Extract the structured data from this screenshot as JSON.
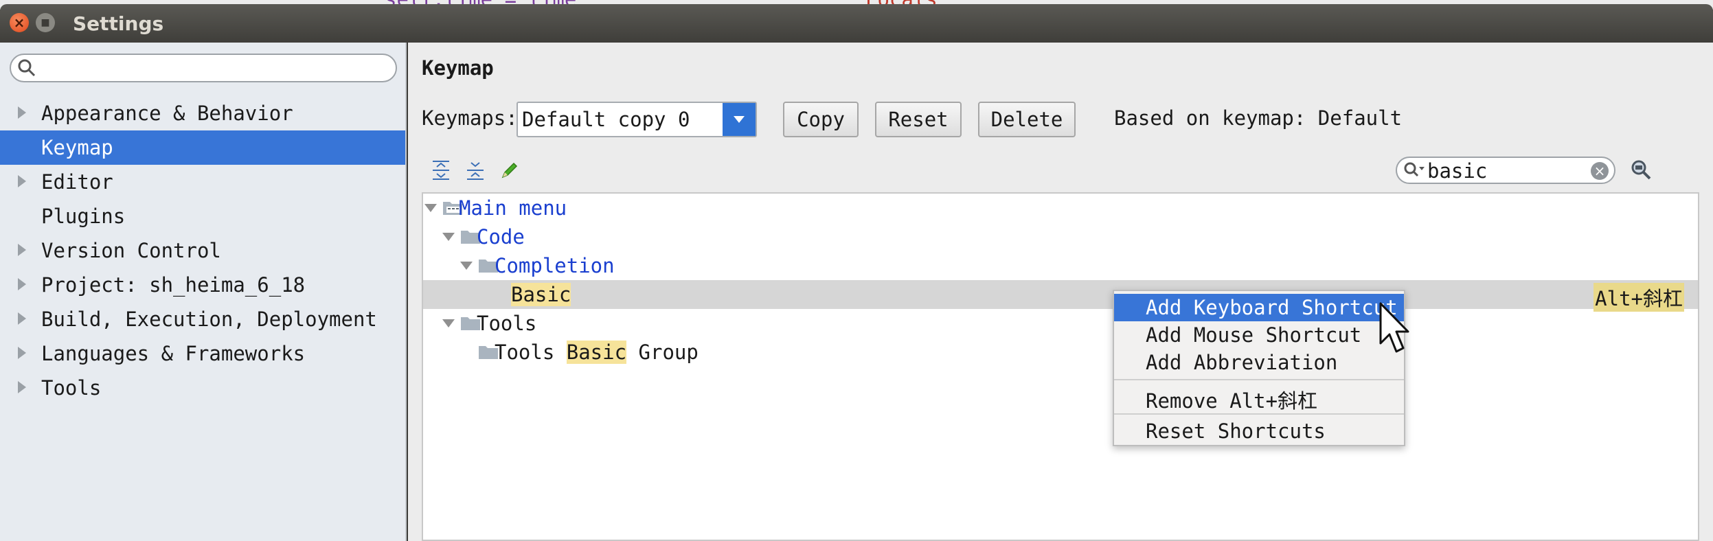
{
  "window": {
    "title": "Settings"
  },
  "background_fragments": [
    "self.time = time",
    "Locals"
  ],
  "sidebar": {
    "search": {
      "placeholder": ""
    },
    "items": [
      {
        "label": "Appearance & Behavior",
        "expandable": true,
        "selected": false
      },
      {
        "label": "Keymap",
        "expandable": false,
        "selected": true
      },
      {
        "label": "Editor",
        "expandable": true,
        "selected": false
      },
      {
        "label": "Plugins",
        "expandable": false,
        "selected": false
      },
      {
        "label": "Version Control",
        "expandable": true,
        "selected": false
      },
      {
        "label": "Project: sh_heima_6_18",
        "expandable": true,
        "selected": false
      },
      {
        "label": "Build, Execution, Deployment",
        "expandable": true,
        "selected": false
      },
      {
        "label": "Languages & Frameworks",
        "expandable": true,
        "selected": false
      },
      {
        "label": "Tools",
        "expandable": true,
        "selected": false
      }
    ]
  },
  "main": {
    "title": "Keymap",
    "keymaps_label": "Keymaps:",
    "keymap_selected": "Default copy 0",
    "buttons": {
      "copy": "Copy",
      "reset": "Reset",
      "delete": "Delete"
    },
    "based_on": "Based on keymap: Default",
    "filter": {
      "value": "basic"
    },
    "toolbar_icons": [
      "expand-all-icon",
      "collapse-all-icon",
      "edit-pencil-icon"
    ]
  },
  "tree": {
    "rows": [
      {
        "label": "Main menu",
        "level": 0,
        "expanded": true,
        "folder": "menu"
      },
      {
        "label": "Code",
        "level": 1,
        "expanded": true,
        "folder": "folder"
      },
      {
        "label": "Completion",
        "level": 2,
        "expanded": true,
        "folder": "folder"
      },
      {
        "label": "Basic",
        "level": 3,
        "selected": true,
        "shortcut": "Alt+斜杠"
      },
      {
        "label": "Tools",
        "level": 1,
        "expanded": true,
        "folder": "folder"
      },
      {
        "label_parts": [
          "Tools ",
          "Basic",
          " Group"
        ],
        "level": 2,
        "folder": "folder"
      }
    ]
  },
  "context_menu": {
    "items": [
      {
        "label": "Add Keyboard Shortcut",
        "active": true
      },
      {
        "label": "Add Mouse Shortcut"
      },
      {
        "label": "Add Abbreviation"
      },
      {
        "label": "Remove Alt+斜杠"
      },
      {
        "label": "Reset Shortcuts"
      }
    ]
  },
  "colors": {
    "selection": "#3875d7",
    "search_highlight": "#f6e39a",
    "link_blue": "#1a3fcf"
  }
}
